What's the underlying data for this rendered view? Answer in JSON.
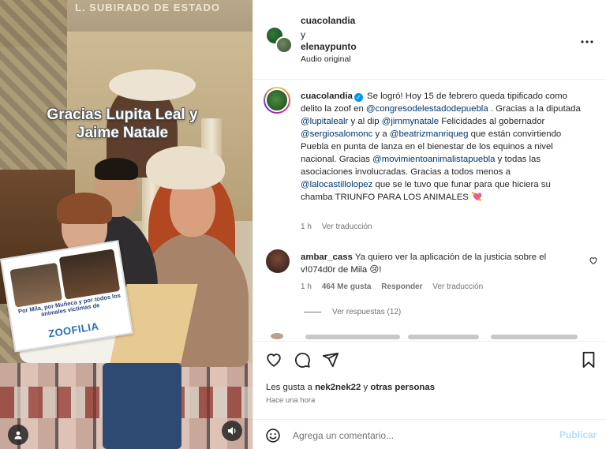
{
  "media": {
    "banner_text": "L. SUBIRADO DE ESTADO",
    "overlay_caption": "Gracias Lupita Leal y Jaime Natale",
    "sign": {
      "text": "Por Mila, por Muñeca y por todos los animales víctimas de",
      "title": "ZOOFILIA"
    },
    "user_tag_icon": "person-icon",
    "audio_icon": "speaker-icon"
  },
  "header": {
    "author1": "cuacolandia",
    "conj": "y",
    "author2": "elenaypunto",
    "audio": "Audio original",
    "more_icon": "more-horizontal-icon"
  },
  "caption": {
    "username": "cuacolandia",
    "t1": " Se logró! Hoy 15 de febrero queda tipificado como delito la zoof en ",
    "m1": "@congresodelestadodepuebla",
    "t2": " . Gracias a la diputada ",
    "m2": "@lupitalealr",
    "t3": " y al dip ",
    "m3": "@jimmynatale",
    "t4": " Felicidades al gobernador ",
    "m4": "@sergiosalomonc",
    "t5": " y a ",
    "m5": "@beatrizmanriqueg",
    "t6": " que están convirtiendo Puebla en punta de lanza en el bienestar de los equinos a nivel nacional. Gracias ",
    "m6": "@movimientoanimalistapuebla",
    "t7": " y todas las asociaciones involucradas. Gracias a todos menos a ",
    "m7": "@lalocastillolopez",
    "t8": " que se le tuvo que funar para que hiciera su chamba TRIUNFO PARA LOS ANIMALES ",
    "emoji": "💘",
    "time": "1 h",
    "see_translation": "Ver traducción"
  },
  "comment": {
    "username": "ambar_cass",
    "text": " Ya quiero ver la aplicación de la justicia sobre el v!074d0r de Mila ",
    "emoji": "😢",
    "tail": "!",
    "time": "1 h",
    "likes": "464 Me gusta",
    "reply": "Responder",
    "see_translation": "Ver traducción",
    "view_replies": "Ver respuestas (12)"
  },
  "actions": {
    "icons": [
      "heart-icon",
      "comment-icon",
      "share-icon",
      "bookmark-icon"
    ],
    "likes_prefix": "Les gusta a ",
    "likes_user": "nek2nek22",
    "likes_suffix": " y ",
    "likes_others": "otras personas",
    "posted": "Hace una hora"
  },
  "add_comment": {
    "placeholder": "Agrega un comentario...",
    "publish": "Publicar"
  },
  "colors": {
    "link": "#00376b",
    "verified": "#0095f6",
    "muted": "#737373",
    "publish_disabled": "#b2dffc"
  }
}
